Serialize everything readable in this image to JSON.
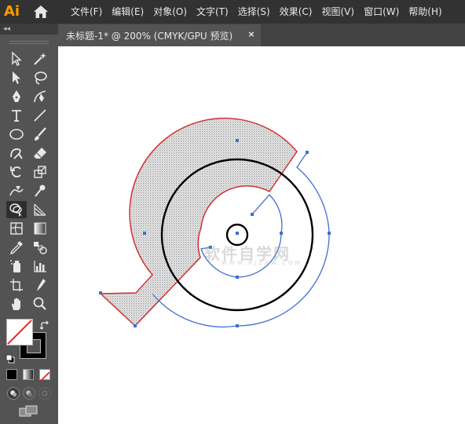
{
  "app": {
    "logo": "Ai"
  },
  "menu": [
    "文件(F)",
    "编辑(E)",
    "对象(O)",
    "文字(T)",
    "选择(S)",
    "效果(C)",
    "视图(V)",
    "窗口(W)",
    "帮助(H)"
  ],
  "tab": {
    "label": "未标题-1* @ 200% (CMYK/GPU 预览)",
    "close": "×"
  },
  "toolbar": {
    "collapse": "◂◂",
    "tools": [
      "selection-icon",
      "magic-wand-icon",
      "direct-selection-icon",
      "lasso-icon",
      "pen-icon",
      "curvature-icon",
      "type-icon",
      "line-segment-icon",
      "ellipse-icon",
      "paintbrush-icon",
      "shaper-icon",
      "eraser-icon",
      "rotate-icon",
      "scale-icon",
      "warp-icon",
      "puppet-warp-icon",
      "shape-builder-icon",
      "perspective-grid-icon",
      "mesh-icon",
      "gradient-icon",
      "eyedropper-icon",
      "blend-icon",
      "symbol-sprayer-icon",
      "column-graph-icon",
      "artboard-icon",
      "slice-icon",
      "hand-icon",
      "zoom-icon"
    ],
    "active_tool": "shape-builder-icon",
    "fill_color": "#ffffff",
    "stroke_color": "#000000"
  },
  "watermark": {
    "text": "软件自学网",
    "sub": "WWW.RJZXW.COM"
  },
  "colors": {
    "accent_path": "#d32f2f",
    "selection": "#3d6fd1",
    "fill_pattern": "#d4d4d4"
  }
}
